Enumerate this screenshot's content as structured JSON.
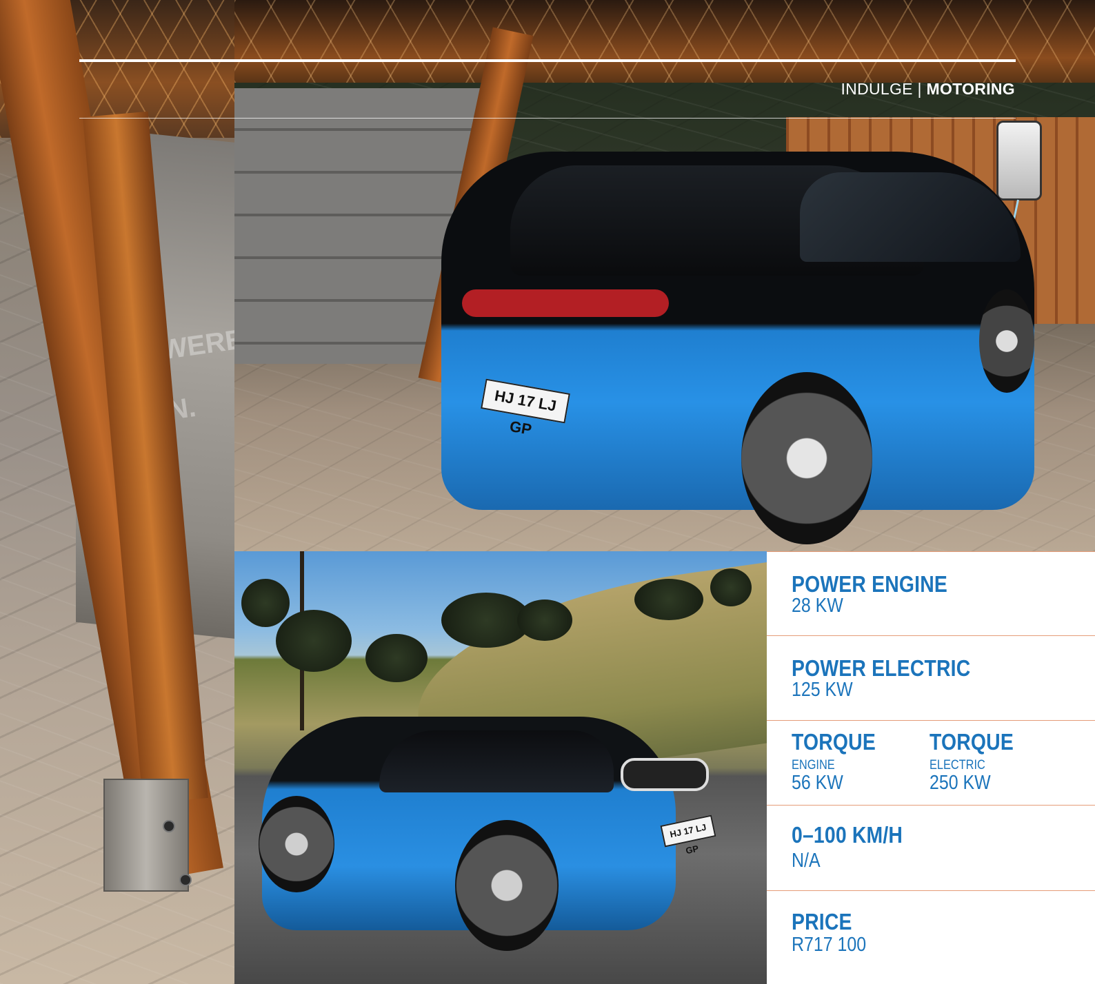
{
  "header": {
    "section": "INDULGE",
    "separator": "|",
    "category": "MOTORING"
  },
  "photos": {
    "left_sign_line1": "POWERED BY",
    "left_sign_line2": "SUN.",
    "top_car_plate": "HJ 17 LJ GP",
    "bottom_car_plate": "HJ 17 LJ GP"
  },
  "specs": {
    "power_engine": {
      "title": "POWER ENGINE",
      "value": "28 KW"
    },
    "power_electric": {
      "title": "POWER ELECTRIC",
      "value": "125 KW"
    },
    "torque_engine": {
      "title": "TORQUE",
      "sub": "ENGINE",
      "value": "56 KW"
    },
    "torque_electric": {
      "title": "TORQUE",
      "sub": "ELECTRIC",
      "value": "250 KW"
    },
    "acceleration": {
      "title": "0–100 KM/H",
      "value": "N/A"
    },
    "price": {
      "title": "PRICE",
      "value": "R717 100"
    }
  },
  "colors": {
    "accent_blue": "#1b74bb",
    "divider_orange": "#e59b77"
  }
}
